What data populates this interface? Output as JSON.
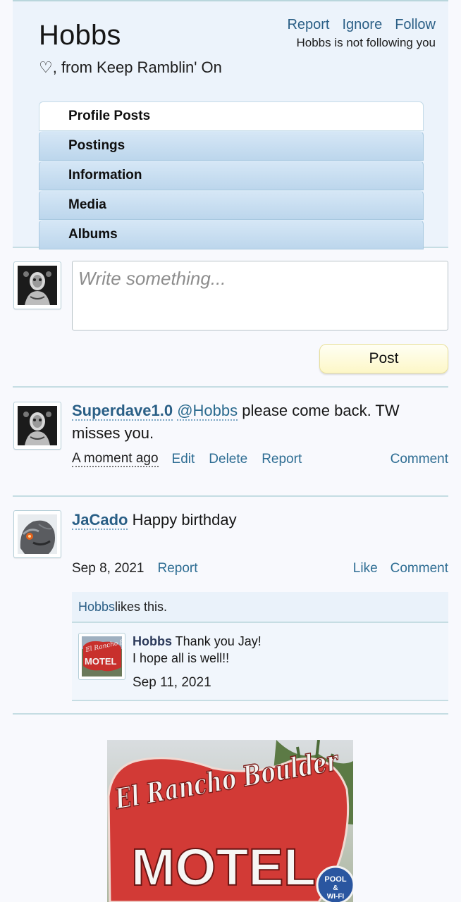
{
  "profile": {
    "name": "Hobbs",
    "subtitle": "♡, from Keep Ramblin' On",
    "actions": {
      "report": "Report",
      "ignore": "Ignore",
      "follow": "Follow"
    },
    "follow_status": "Hobbs is not following you",
    "tabs": [
      "Profile Posts",
      "Postings",
      "Information",
      "Media",
      "Albums"
    ]
  },
  "composer": {
    "placeholder": "Write something...",
    "post_label": "Post"
  },
  "posts": [
    {
      "author": "Superdave1.0",
      "mention": "@Hobbs",
      "text": " please come back. TW misses you.",
      "time": "A moment ago",
      "actions": {
        "edit": "Edit",
        "delete": "Delete",
        "report": "Report",
        "comment": "Comment"
      }
    },
    {
      "author": "JaCado",
      "text": "Happy birthday",
      "time": "Sep 8, 2021",
      "actions": {
        "report": "Report",
        "like": "Like",
        "comment": "Comment"
      },
      "likes": {
        "liker": "Hobbs",
        "suffix": " likes this."
      },
      "comment": {
        "author": "Hobbs",
        "line1": " Thank you Jay!",
        "line2": "I hope all is well!!",
        "date": "Sep 11, 2021"
      }
    }
  ],
  "image_sign": {
    "script_text": "El Rancho Boulder",
    "block_text": "MOTEL",
    "badge_line1": "POOL",
    "badge_line2": "&",
    "badge_line3": "WI-FI",
    "thumb_script": "El Rancho Boulder",
    "thumb_block": "MOTEL"
  },
  "colors": {
    "accent": "#2b5f86",
    "header_bg": "#ecf3fb",
    "divider": "#c5dde3",
    "post_button": "#fdf7c7",
    "sign_red": "#d23a36"
  }
}
